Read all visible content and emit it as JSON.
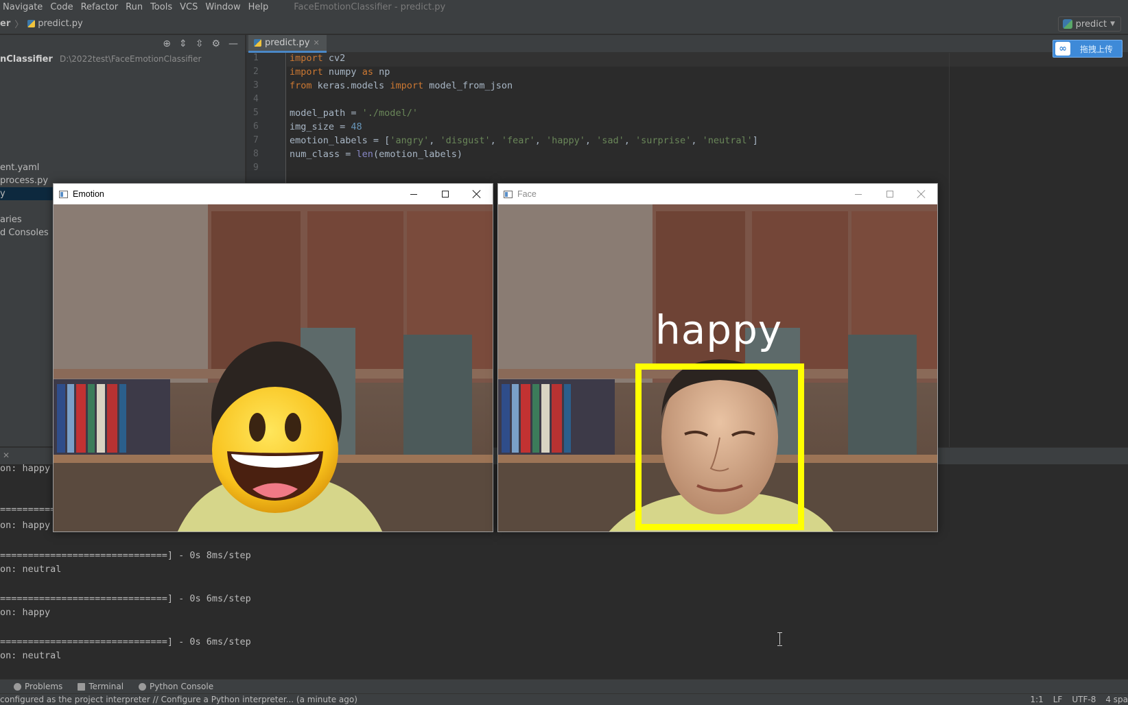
{
  "menu": {
    "items": [
      "Navigate",
      "Code",
      "Refactor",
      "Run",
      "Tools",
      "VCS",
      "Window",
      "Help"
    ],
    "window_title": "FaceEmotionClassifier - predict.py"
  },
  "navbar": {
    "crumb_project": "er",
    "crumb_file": "predict.py",
    "run_config": "predict"
  },
  "project": {
    "root_name": "nClassifier",
    "root_path": "D:\\2022test\\FaceEmotionClassifier",
    "items": [
      "ent.yaml",
      "process.py",
      "y",
      "aries",
      "d Consoles"
    ]
  },
  "editor": {
    "tab_label": "predict.py",
    "upload_button": "拖拽上传",
    "line_numbers": [
      "1",
      "2",
      "3",
      "4",
      "5",
      "6",
      "7",
      "8",
      "9"
    ],
    "code": {
      "l1": [
        "import",
        " cv2"
      ],
      "l2": [
        "import",
        " numpy ",
        "as",
        " np"
      ],
      "l3": [
        "from",
        " keras.models ",
        "import",
        " model_from_json"
      ],
      "l5": [
        "model_path = ",
        "'./model/'"
      ],
      "l6": [
        "img_size = ",
        "48"
      ],
      "l7": [
        "emotion_labels = [",
        "'angry'",
        ", ",
        "'disgust'",
        ", ",
        "'fear'",
        ", ",
        "'happy'",
        ", ",
        "'sad'",
        ", ",
        "'surprise'",
        ", ",
        "'neutral'",
        "]"
      ],
      "l8": [
        "num_class = ",
        "len",
        "(emotion_labels)"
      ]
    }
  },
  "console": {
    "lines": [
      "on: happy",
      "==============================",
      "on: happy",
      "==============================] - 0s 8ms/step",
      "on: neutral",
      "==============================] - 0s 6ms/step",
      "on: happy",
      "==============================] - 0s 6ms/step",
      "on: neutral"
    ]
  },
  "toolstrip": {
    "problems": "Problems",
    "terminal": "Terminal",
    "python_console": "Python Console"
  },
  "status": {
    "message": "configured as the project interpreter // Configure a Python interpreter... (a minute ago)",
    "position": "1:1",
    "line_sep": "LF",
    "encoding": "UTF-8",
    "indent": "4 spa"
  },
  "windows": {
    "emotion_title": "Emotion",
    "face_title": "Face",
    "face_label": "happy"
  },
  "colors": {
    "face_box": "#ffff00",
    "editor_bg": "#2b2b2b",
    "panel_bg": "#3c3f41"
  }
}
